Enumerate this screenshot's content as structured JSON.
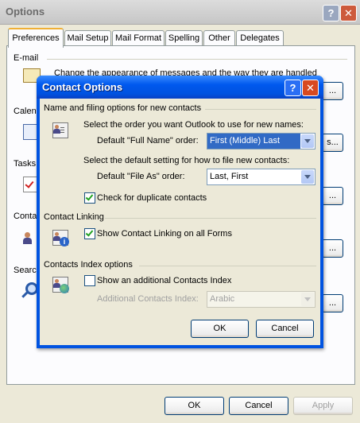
{
  "outer_window": {
    "title": "Options",
    "help_label": "?",
    "close_label": "✕",
    "tabs": [
      "Preferences",
      "Mail Setup",
      "Mail Format",
      "Spelling",
      "Other",
      "Delegates"
    ],
    "sections": {
      "email": "E-mail",
      "email_desc": "Change the appearance of messages and the way they are handled",
      "calendar": "Calend",
      "tasks": "Tasks",
      "contacts": "Conta",
      "search": "Search"
    },
    "side_buttons": [
      "...",
      "s...",
      "...",
      "...",
      "...",
      "..."
    ],
    "buttons": {
      "ok": "OK",
      "cancel": "Cancel",
      "apply": "Apply"
    }
  },
  "dialog": {
    "title": "Contact Options",
    "help_label": "?",
    "close_label": "✕",
    "group1": {
      "title": "Name and filing options for new contacts",
      "full_name_prompt": "Select the order you want Outlook to use for new names:",
      "full_name_label": "Default \"Full Name\" order:",
      "full_name_value": "First (Middle) Last",
      "file_as_prompt": "Select the default setting for how to file new contacts:",
      "file_as_label": "Default \"File As\" order:",
      "file_as_value": "Last, First",
      "duplicate_check_label": "Check for duplicate contacts",
      "duplicate_checked": true
    },
    "group2": {
      "title": "Contact Linking",
      "linking_label": "Show Contact Linking on all Forms",
      "linking_checked": true
    },
    "group3": {
      "title": "Contacts Index options",
      "additional_index_label": "Show an additional Contacts Index",
      "additional_index_checked": false,
      "index_select_label": "Additional Contacts Index:",
      "index_select_value": "Arabic"
    },
    "buttons": {
      "ok": "OK",
      "cancel": "Cancel"
    }
  }
}
